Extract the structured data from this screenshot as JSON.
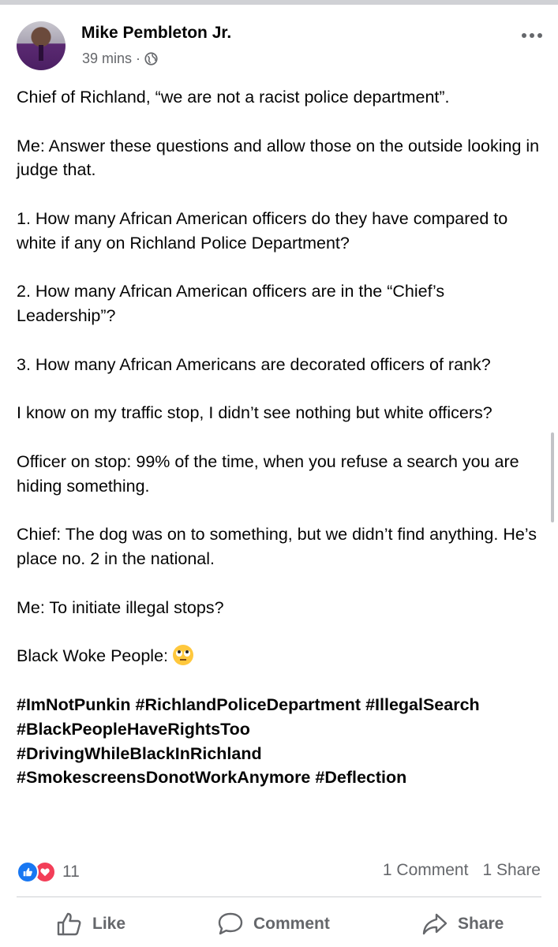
{
  "post": {
    "author": "Mike Pembleton Jr.",
    "time": "39 mins",
    "separator": "·",
    "paragraphs": [
      "Chief of Richland, “we are not a racist police department”.",
      "Me: Answer these questions and allow those on the outside looking in judge that.",
      "1. How many African American officers do they have compared to white if any on Richland Police Department?",
      "2. How many African American officers are in the “Chief’s Leadership”?",
      "3. How many African Americans are decorated officers of rank?",
      "I know on my traffic stop, I didn’t see nothing but white officers?",
      "Officer on stop: 99% of the time, when you refuse a search you are hiding something.",
      "Chief: The dog was on to something, but we didn’t find anything. He’s place no. 2 in the national.",
      "Me: To initiate illegal stops?",
      "Black Woke People:"
    ],
    "emoji": "eye-roll-emoji",
    "hashtags": [
      "#ImNotPunkin",
      "#RichlandPoliceDepartment",
      "#IllegalSearch",
      "#BlackPeopleHaveRightsToo",
      "#DrivingWhileBlackInRichland",
      "#SmokescreensDonotWorkAnymore",
      "#Deflection"
    ]
  },
  "stats": {
    "reaction_count": "11",
    "comments": "1 Comment",
    "shares": "1 Share"
  },
  "actions": {
    "like": "Like",
    "comment": "Comment",
    "share": "Share"
  },
  "colors": {
    "text": "#050505",
    "secondary": "#65676b",
    "like_blue": "#1877f2",
    "love_red": "#f33e58",
    "divider": "#ced0d4"
  }
}
